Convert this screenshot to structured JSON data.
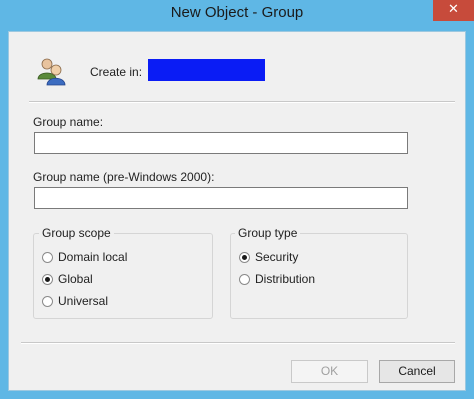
{
  "window": {
    "title": "New Object - Group",
    "close_glyph": "✕"
  },
  "header": {
    "icon": "group-users-icon",
    "create_in_label": "Create in:",
    "create_in_value": "",
    "create_in_color": "#0a1cf5"
  },
  "fields": {
    "group_name_label": "Group name:",
    "group_name_value": "",
    "group_name_pre2000_label": "Group name (pre-Windows 2000):",
    "group_name_pre2000_value": ""
  },
  "group_scope": {
    "title": "Group scope",
    "options": [
      {
        "label": "Domain local",
        "checked": false
      },
      {
        "label": "Global",
        "checked": true
      },
      {
        "label": "Universal",
        "checked": false
      }
    ]
  },
  "group_type": {
    "title": "Group type",
    "options": [
      {
        "label": "Security",
        "checked": true
      },
      {
        "label": "Distribution",
        "checked": false
      }
    ]
  },
  "buttons": {
    "ok_label": "OK",
    "ok_enabled": false,
    "cancel_label": "Cancel"
  },
  "colors": {
    "titlebar": "#5fb7e5",
    "close_button": "#c74b3b",
    "dialog_background": "#f0f0f0"
  }
}
